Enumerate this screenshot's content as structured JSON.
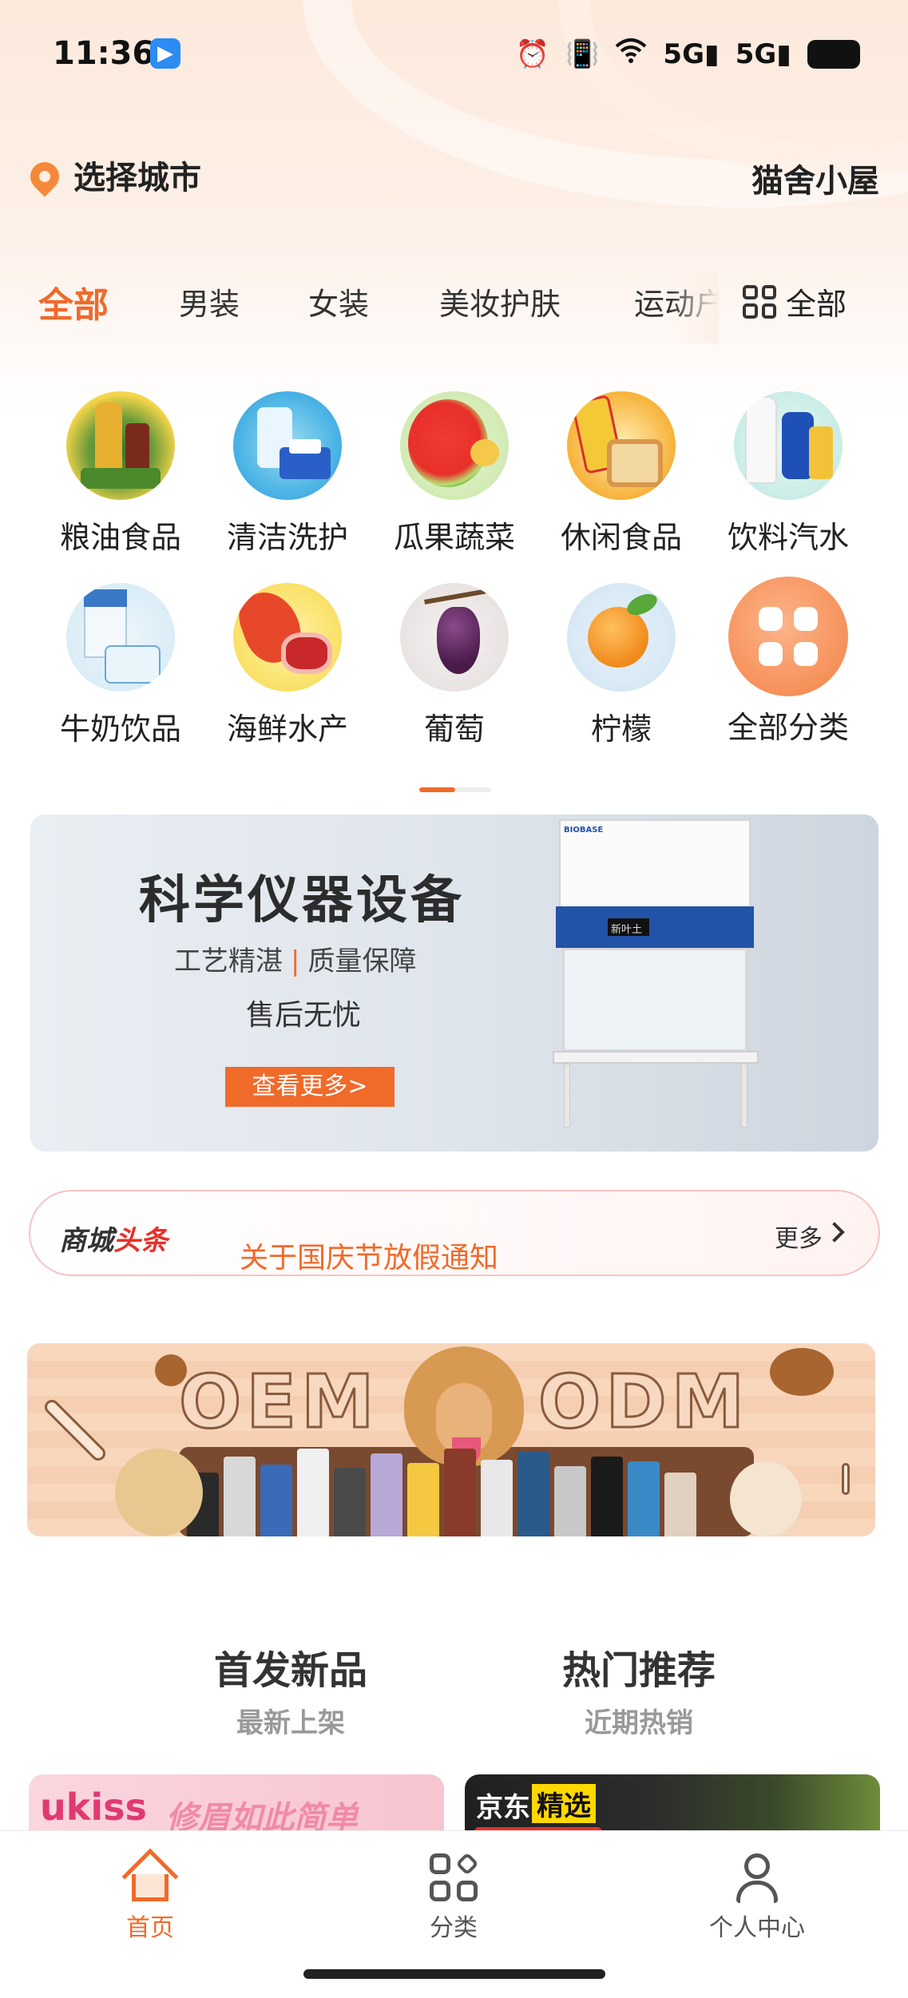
{
  "status_bar": {
    "time": "11:36",
    "app_badge_icon": "blue-play-app-icon",
    "signal1": "5G",
    "signal2": "5G",
    "battery": "63",
    "icons": [
      "alarm-icon",
      "vibrate-icon",
      "wifi-icon",
      "signal-5g-icon",
      "signal-5g-icon",
      "battery-icon"
    ]
  },
  "header": {
    "location_icon": "location-pin-icon",
    "city_label": "选择城市",
    "shop_name": "猫舍小屋"
  },
  "tabs": {
    "items": [
      {
        "label": "全部",
        "active": true
      },
      {
        "label": "男装",
        "active": false
      },
      {
        "label": "女装",
        "active": false
      },
      {
        "label": "美妆护肤",
        "active": false
      },
      {
        "label": "运动户",
        "active": false
      }
    ],
    "all_button": {
      "icon": "grid-icon",
      "label": "全部"
    }
  },
  "categories": [
    {
      "label": "粮油食品",
      "icon": "grain-oil-icon"
    },
    {
      "label": "清洁洗护",
      "icon": "cleaning-icon"
    },
    {
      "label": "瓜果蔬菜",
      "icon": "watermelon-icon"
    },
    {
      "label": "休闲食品",
      "icon": "snack-icon"
    },
    {
      "label": "饮料汽水",
      "icon": "drink-icon"
    },
    {
      "label": "牛奶饮品",
      "icon": "milk-icon"
    },
    {
      "label": "海鲜水产",
      "icon": "seafood-icon"
    },
    {
      "label": "葡萄",
      "icon": "grape-icon"
    },
    {
      "label": "柠檬",
      "icon": "orange-icon"
    },
    {
      "label": "全部分类",
      "icon": "all-categories-icon"
    }
  ],
  "banner": {
    "title": "科学仪器设备",
    "subtitle_left": "工艺精湛",
    "subtitle_sep": "|",
    "subtitle_right": "质量保障",
    "subtitle2": "售后无忧",
    "button": "查看更多>",
    "product_brand": "BIOBASE",
    "product_panel": "新叶土"
  },
  "news": {
    "brand_black": "商城",
    "brand_red": "头条",
    "text": "关于国庆节放假通知",
    "more": "更多"
  },
  "oem_banner": {
    "left_text": "OEM",
    "right_text": "ODM"
  },
  "sections": [
    {
      "title": "首发新品",
      "subtitle": "最新上架"
    },
    {
      "title": "热门推荐",
      "subtitle": "近期热销"
    }
  ],
  "cards": {
    "card1_brand": "ukiss",
    "card1_slogan": "修眉如此简单",
    "card2_jd": "京东",
    "card2_jx": "精选"
  },
  "bottom_nav": [
    {
      "label": "首页",
      "icon": "home-icon",
      "active": true
    },
    {
      "label": "分类",
      "icon": "category-grid-icon",
      "active": false
    },
    {
      "label": "个人中心",
      "icon": "user-icon",
      "active": false
    }
  ],
  "colors": {
    "accent": "#f06a2a",
    "news_red": "#e8302a",
    "banner_button": "#f06a2a"
  }
}
